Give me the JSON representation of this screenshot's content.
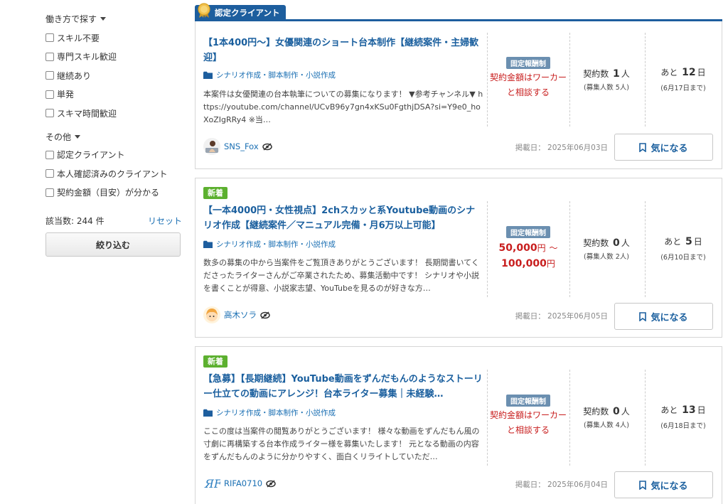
{
  "sidebar": {
    "group1_title": "働き方で探す",
    "group1_items": [
      "スキル不要",
      "専門スキル歓迎",
      "継続あり",
      "単発",
      "スキマ時間歓迎"
    ],
    "group2_title": "その他",
    "group2_items": [
      "認定クライアント",
      "本人確認済みのクライアント",
      "契約金額（目安）が分かる"
    ],
    "count_text": "該当数: 244 件",
    "reset_label": "リセット",
    "filter_button": "絞り込む"
  },
  "cert_tab_label": "認定クライアント",
  "jobs": [
    {
      "badge": "",
      "title": "【1本400円～】女優関連のショート台本制作【継続案件・主婦歓迎】",
      "category": "シナリオ作成・脚本制作・小説作成",
      "description": "本案件は女優関連の台本執筆についての募集になります！ ▼参考チャンネル▼ https://youtube.com/channel/UCvB96y7gn4xKSu0FgthjDSA?si=Y9e0_hoXoZIgRRy4 ※当…",
      "price_type": "固定報酬制",
      "price_text": "契約金額はワーカーと相談する",
      "contract_label": "契約数",
      "contract_count": "1",
      "contract_unit": "人",
      "applicants": "(募集人数 5人)",
      "deadline_prefix": "あと",
      "deadline_days": "12",
      "deadline_unit": "日",
      "deadline_date": "(6月17日まで)",
      "owner": "SNS_Fox",
      "posted": "掲載日： 2025年06月03日",
      "fav_label": "気になる"
    },
    {
      "badge": "新着",
      "title": "【一本4000円・女性視点】2chスカッと系Youtube動画のシナリオ作成【継続案件／マニュアル完備・月6万以上可能】",
      "category": "シナリオ作成・脚本制作・小説作成",
      "description": "数多の募集の中から当案件をご覧頂きありがとうございます！ 長期間書いてくださったライターさんがご卒業されたため、募集活動中です！ シナリオや小説を書くことが得意、小説家志望、YouTubeを見るのが好きな方…",
      "price_type": "固定報酬制",
      "price_min": "50,000",
      "price_max": "100,000",
      "price_yen": "円",
      "price_tilde": "～",
      "contract_label": "契約数",
      "contract_count": "0",
      "contract_unit": "人",
      "applicants": "(募集人数 2人)",
      "deadline_prefix": "あと",
      "deadline_days": "5",
      "deadline_unit": "日",
      "deadline_date": "(6月10日まで)",
      "owner": "高木ソラ",
      "posted": "掲載日： 2025年06月05日",
      "fav_label": "気になる"
    },
    {
      "badge": "新着",
      "title": "【急募】【長期継続】YouTube動画をずんだもんのようなストーリー仕立ての動画にアレンジ！台本ライター募集｜未経験…",
      "category": "シナリオ作成・脚本制作・小説作成",
      "description": "ここの度は当案件の閲覧ありがとうございます！ 様々な動画をずんだもん風の寸劇に再構築する台本作成ライター様を募集いたします！ 元となる動画の内容をずんだもんのように分かりやすく、面白くリライトしていただ…",
      "price_type": "固定報酬制",
      "price_text": "契約金額はワーカーと相談する",
      "contract_label": "契約数",
      "contract_count": "0",
      "contract_unit": "人",
      "applicants": "(募集人数 4人)",
      "deadline_prefix": "あと",
      "deadline_days": "13",
      "deadline_unit": "日",
      "deadline_date": "(6月18日まで)",
      "owner": "RIFA0710",
      "posted": "掲載日： 2025年06月04日",
      "fav_label": "気になる"
    }
  ],
  "colors": {
    "link_blue": "#1a5f9e",
    "cert_blue": "#1d5e9e",
    "new_green": "#5cb02f",
    "price_red": "#c81e1e",
    "tag_gray_blue": "#6b8fb0"
  }
}
